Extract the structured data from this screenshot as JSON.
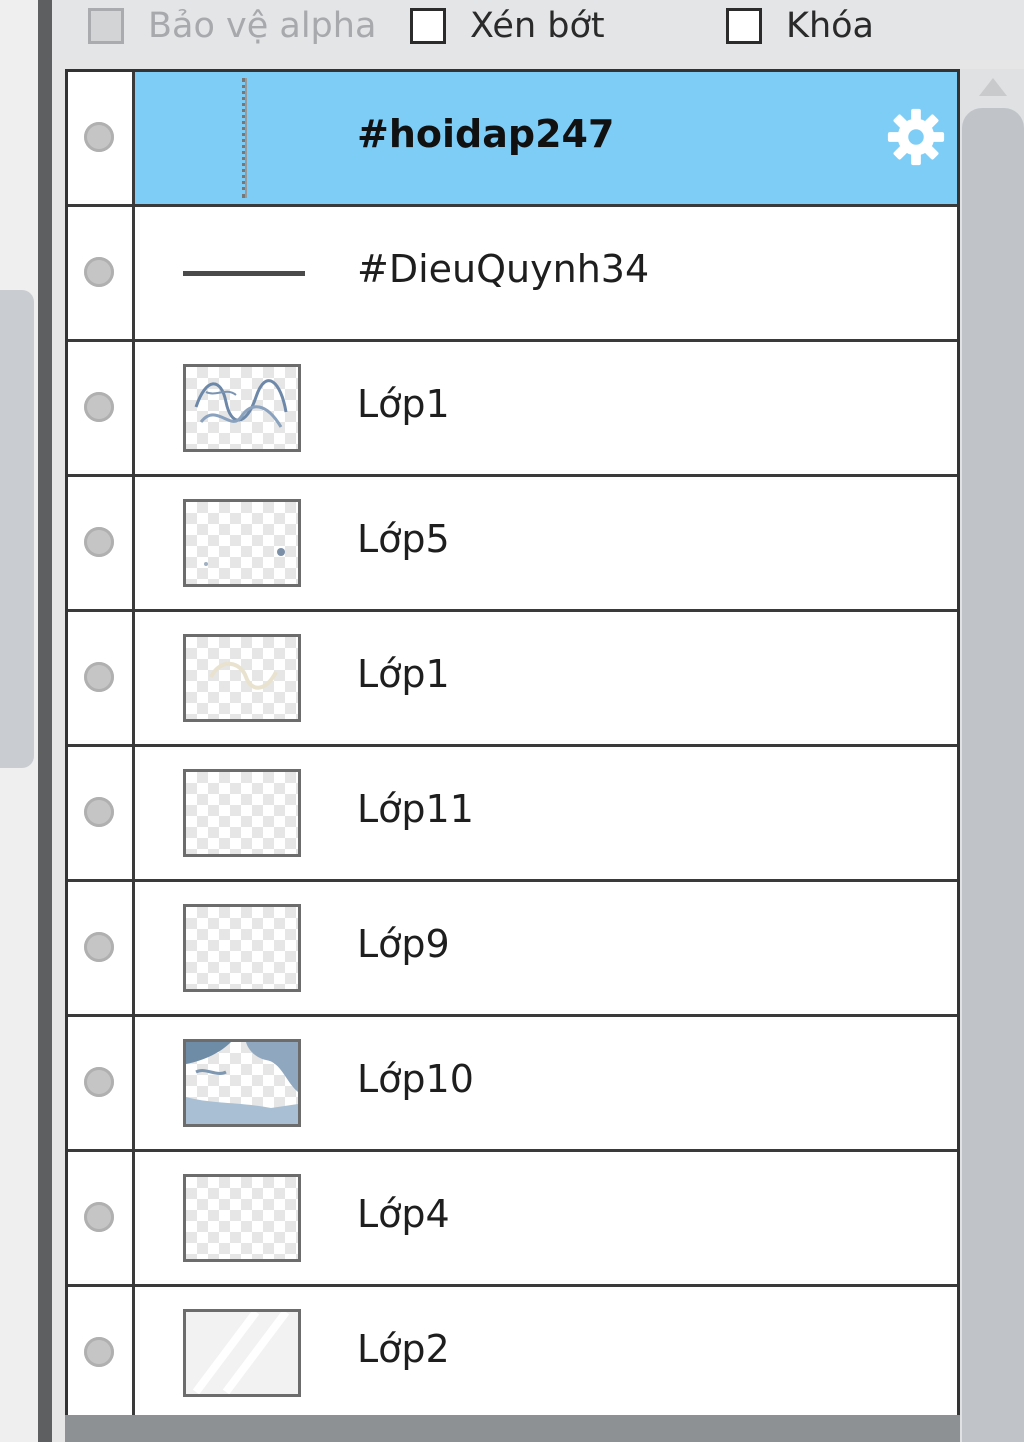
{
  "toolbar": {
    "alpha_protect": {
      "label": "Bảo vệ alpha",
      "checked": false,
      "enabled": false
    },
    "clip": {
      "label": "Xén bớt",
      "checked": false,
      "enabled": true
    },
    "lock": {
      "label": "Khóa",
      "checked": false,
      "enabled": true
    }
  },
  "layers": [
    {
      "name": "#hoidap247",
      "selected": true,
      "kind": "text"
    },
    {
      "name": "#DieuQuynh34",
      "selected": false,
      "kind": "text"
    },
    {
      "name": "Lớp1",
      "selected": false,
      "kind": "image"
    },
    {
      "name": "Lớp5",
      "selected": false,
      "kind": "image"
    },
    {
      "name": "Lớp1",
      "selected": false,
      "kind": "image"
    },
    {
      "name": "Lớp11",
      "selected": false,
      "kind": "image"
    },
    {
      "name": "Lớp9",
      "selected": false,
      "kind": "image"
    },
    {
      "name": "Lớp10",
      "selected": false,
      "kind": "image"
    },
    {
      "name": "Lớp4",
      "selected": false,
      "kind": "image"
    },
    {
      "name": "Lớp2",
      "selected": false,
      "kind": "image"
    }
  ],
  "colors": {
    "selection": "#7ecdf6",
    "border": "#333333"
  },
  "icons": {
    "settings": "gear-icon",
    "visibility": "visibility-dot-icon"
  }
}
